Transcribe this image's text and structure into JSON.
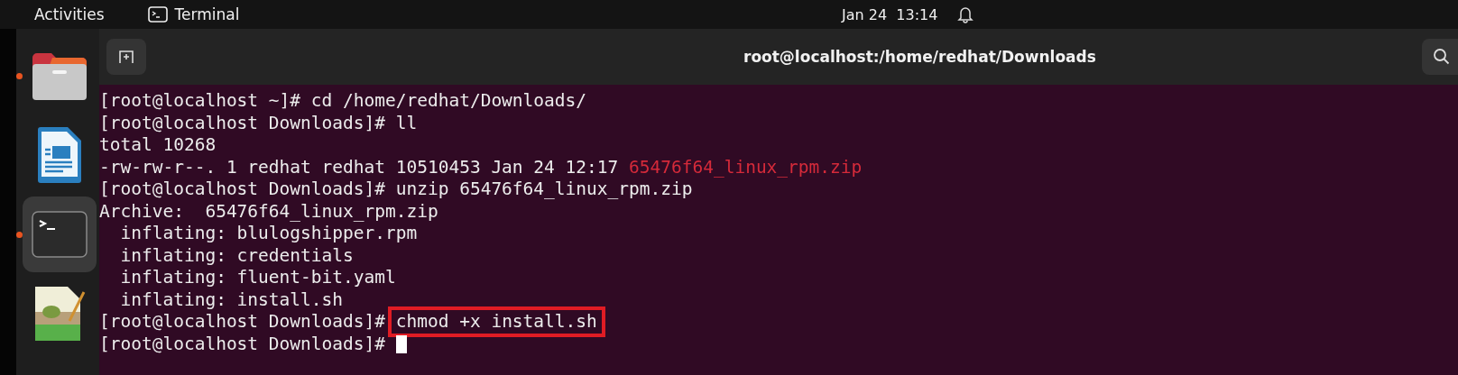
{
  "top_bar": {
    "activities": "Activities",
    "app_name": "Terminal",
    "clock": "Jan 24  13:14"
  },
  "dock": [
    {
      "kind": "files",
      "running": true,
      "selected": false
    },
    {
      "kind": "writer",
      "running": false,
      "selected": false
    },
    {
      "kind": "terminal",
      "running": true,
      "selected": true
    },
    {
      "kind": "editor",
      "running": false,
      "selected": false
    }
  ],
  "terminal": {
    "title": "root@localhost:/home/redhat/Downloads",
    "lines": [
      {
        "segments": [
          {
            "text": "[root@localhost ~]# cd /home/redhat/Downloads/",
            "kind": "plain"
          }
        ]
      },
      {
        "segments": [
          {
            "text": "[root@localhost Downloads]# ll",
            "kind": "plain"
          }
        ]
      },
      {
        "segments": [
          {
            "text": "total 10268",
            "kind": "plain"
          }
        ]
      },
      {
        "segments": [
          {
            "text": "-rw-rw-r--. 1 redhat redhat 10510453 Jan 24 12:17 ",
            "kind": "plain"
          },
          {
            "text": "65476f64_linux_rpm.zip",
            "kind": "archive"
          }
        ]
      },
      {
        "segments": [
          {
            "text": "[root@localhost Downloads]# unzip 65476f64_linux_rpm.zip",
            "kind": "plain"
          }
        ]
      },
      {
        "segments": [
          {
            "text": "Archive:  65476f64_linux_rpm.zip",
            "kind": "plain"
          }
        ]
      },
      {
        "segments": [
          {
            "text": "  inflating: blulogshipper.rpm",
            "kind": "plain"
          }
        ]
      },
      {
        "segments": [
          {
            "text": "  inflating: credentials",
            "kind": "plain"
          }
        ]
      },
      {
        "segments": [
          {
            "text": "  inflating: fluent-bit.yaml",
            "kind": "plain"
          }
        ]
      },
      {
        "segments": [
          {
            "text": "  inflating: install.sh",
            "kind": "plain"
          }
        ]
      },
      {
        "segments": [
          {
            "text": "[root@localhost Downloads]# ",
            "kind": "plain"
          },
          {
            "text": "chmod +x install.sh",
            "kind": "highlight"
          }
        ]
      },
      {
        "segments": [
          {
            "text": "[root@localhost Downloads]# ",
            "kind": "plain"
          }
        ],
        "cursor": true
      }
    ]
  }
}
